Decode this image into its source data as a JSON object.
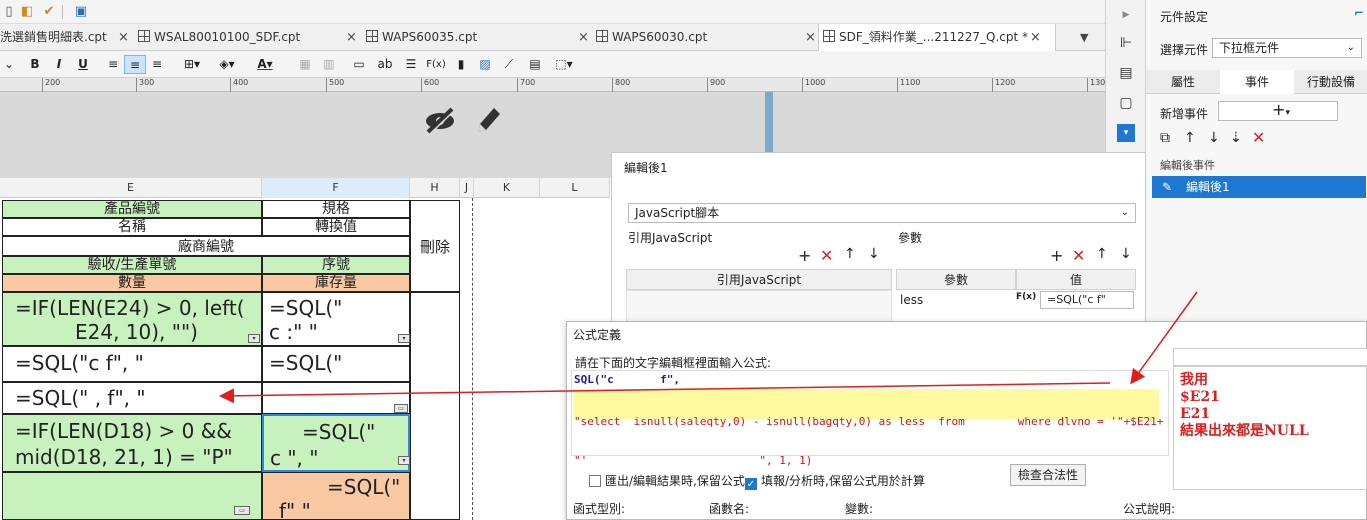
{
  "colors": {
    "accent": "#1e78d2",
    "green_cell": "#c8f2bd",
    "orange_cell": "#f9c9a4",
    "annotation_red": "#e11d1d"
  },
  "quick_toolbar": {
    "icons": [
      "paste-icon",
      "format-painter-icon",
      "brush-icon",
      "preview-icon"
    ]
  },
  "tabs": [
    {
      "label": "洗選銷售明細表.cpt"
    },
    {
      "label": "WSAL80010100_SDF.cpt"
    },
    {
      "label": "WAPS60035.cpt"
    },
    {
      "label": "WAPS60030.cpt"
    },
    {
      "label": "SDF_領料作業_...211227_Q.cpt *"
    }
  ],
  "format_toolbar": {
    "bold": "B",
    "italic": "I",
    "underline": "U",
    "text_icon": "ab",
    "fx": "F(x)",
    "color_letter": "A"
  },
  "ruler": {
    "ticks": [
      "200",
      "300",
      "400",
      "500",
      "600",
      "700",
      "800",
      "900",
      "1000",
      "1100",
      "1200",
      "130"
    ]
  },
  "sheet": {
    "columns": [
      "E",
      "F",
      "H",
      "J",
      "K",
      "L"
    ],
    "header_rows": {
      "product_code": "產品編號",
      "spec": "規格",
      "name": "名稱",
      "conversion": "轉換值",
      "vendor_code": "廠商編號",
      "delete": "刪除",
      "receipt_no": "驗收/生產單號",
      "seq": "序號",
      "qty": "數量",
      "stock": "庫存量"
    },
    "formulas": {
      "e_row1_line1": "=IF(LEN(E24) > 0, left(",
      "e_row1_line2": "E24, 10), \"\")",
      "f_row1_line1": "=SQL(\"",
      "f_row1_line2": "c         :\"  \"",
      "e_row2": "=SQL(\"c           f\", \"",
      "f_row2": "=SQL(\"",
      "e_row3": "=SQL(\"  ,      f\", \"",
      "e_row4_line1": "=IF(LEN(D18) > 0 &&",
      "e_row4_line2": "mid(D18, 21, 1) = \"P\"",
      "f_row4_line1": "=SQL(\"",
      "f_row4_line2": "c          \", \"",
      "f_row5_line1": "=SQL(\"",
      "f_row5_line2": "          f\"  \""
    }
  },
  "band_icons": [
    "eye-slash-icon",
    "pencil-icon"
  ],
  "settings_panel": {
    "title": "元件設定",
    "select_component_label": "選擇元件",
    "select_component_value": "下拉框元件",
    "tabs": [
      "屬性",
      "事件",
      "行動設備"
    ],
    "add_event_label": "新增事件",
    "add_symbol": "+",
    "event_group_title": "編輯後事件",
    "event_item": "編輯後1"
  },
  "edit_dialog": {
    "title": "編輯後1",
    "script_type": "JavaScript腳本",
    "ref_js_section": "引用JavaScript",
    "ref_js_header": "引用JavaScript",
    "params_section": "參數",
    "params_header_param": "參數",
    "params_header_value": "值",
    "param_name": "less",
    "param_value": "=SQL(\"c          f\""
  },
  "formula_dialog": {
    "title": "公式定義",
    "prompt": "請在下面的文字編輯框裡面輸入公式:",
    "line1": "SQL(\"c       f\",",
    "line2": "\"select  isnull(saleqty,0) - isnull(bagqty,0) as less  from        where dlvno = '\"+$E21+",
    "line3": "\"'                          \", 1, 1)",
    "checkbox_keep_formula_export": "匯出/編輯結果時,保留公式",
    "checkbox_keep_formula_fill": "填報/分析時,保留公式用於計算",
    "check_validity_button": "檢查合法性",
    "function_type_label": "函式型別:",
    "function_name_label": "函數名:",
    "variable_label": "變數:",
    "formula_desc_label": "公式說明:"
  },
  "annotation": {
    "line1": "我用",
    "line2": "$E21",
    "line3": "E21",
    "line4": "結果出來都是NULL"
  }
}
